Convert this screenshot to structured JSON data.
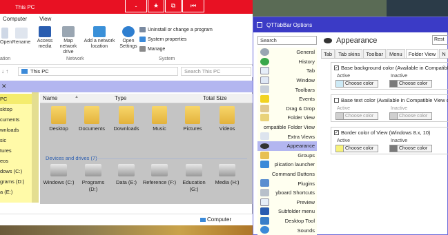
{
  "explorer": {
    "title": "This PC",
    "tabs": [
      "Computer",
      "View"
    ],
    "ribbon": {
      "open": "Open",
      "rename": "Rename",
      "access_media": "Access media",
      "map_drive": "Map network drive",
      "add_location": "Add a network location",
      "open_settings": "Open Settings",
      "uninstall": "Uninstall or change a program",
      "system_properties": "System properties",
      "manage": "Manage",
      "group_location": "ation",
      "group_network": "Network",
      "group_system": "System"
    },
    "address": "This PC",
    "search_placeholder": "Search This PC",
    "columns": [
      "Name",
      "Type",
      "Total Size"
    ],
    "nav_items": [
      "PC",
      "sktop",
      "cuments",
      "wnloads",
      "sic",
      "tures",
      "eos",
      "dows (C:)",
      "grams (D:)",
      "a (E:)"
    ],
    "folders": [
      "Desktop",
      "Documents",
      "Downloads",
      "Music",
      "Pictures",
      "Videos"
    ],
    "devices_header": "Devices and drives (7)",
    "drives": [
      {
        "name": "Windows (C:)",
        "name2": ""
      },
      {
        "name": "Programs",
        "name2": "(D:)"
      },
      {
        "name": "Data (E:)",
        "name2": ""
      },
      {
        "name": "Reference (F:)",
        "name2": ""
      },
      {
        "name": "Education",
        "name2": "(G:)"
      },
      {
        "name": "Media (H:)",
        "name2": ""
      }
    ],
    "status_location": "Computer",
    "titlebar_buttons": [
      "-",
      "★",
      "⧉",
      "⏮"
    ]
  },
  "dialog": {
    "title": "QTTabBar Options",
    "search": "Search",
    "categories": [
      "General",
      "History",
      "Tab",
      "Window",
      "Toolbars",
      "Events",
      "Drag & Drop",
      "Folder View",
      "ompatible Folder View",
      "Extra Views",
      "Appearance",
      "Groups",
      "plication launcher",
      "Command Buttons",
      "Plugins",
      "yboard Shortcuts",
      "Preview",
      "Subfolder menu",
      "Desktop Tool",
      "Sounds"
    ],
    "selected_category": "Appearance",
    "header": "Appearance",
    "restore": "Rest",
    "tabs": [
      "Tab",
      "Tab skins",
      "Toolbar",
      "Menu",
      "Folder View",
      "N"
    ],
    "groups": [
      {
        "label": "Base background color (Available in Compatible",
        "checked": true,
        "active": "Active",
        "inactive": "Inactive",
        "choose": "Choose color"
      },
      {
        "label": "Base text color (Available in Compatible View c",
        "checked": false,
        "active": "Active",
        "inactive": "Inactive",
        "choose": "Choose color"
      },
      {
        "label": "Border color of View (Windows 8.x, 10)",
        "checked": true,
        "active": "Active",
        "inactive": "Inactive",
        "choose": "Choose color"
      }
    ],
    "colors": {
      "accent": "#3b3bc6",
      "active_swatch_1": "#cdeaf6",
      "inactive_swatch": "#7a7a7a",
      "active_swatch_3": "#f7f27a"
    }
  }
}
